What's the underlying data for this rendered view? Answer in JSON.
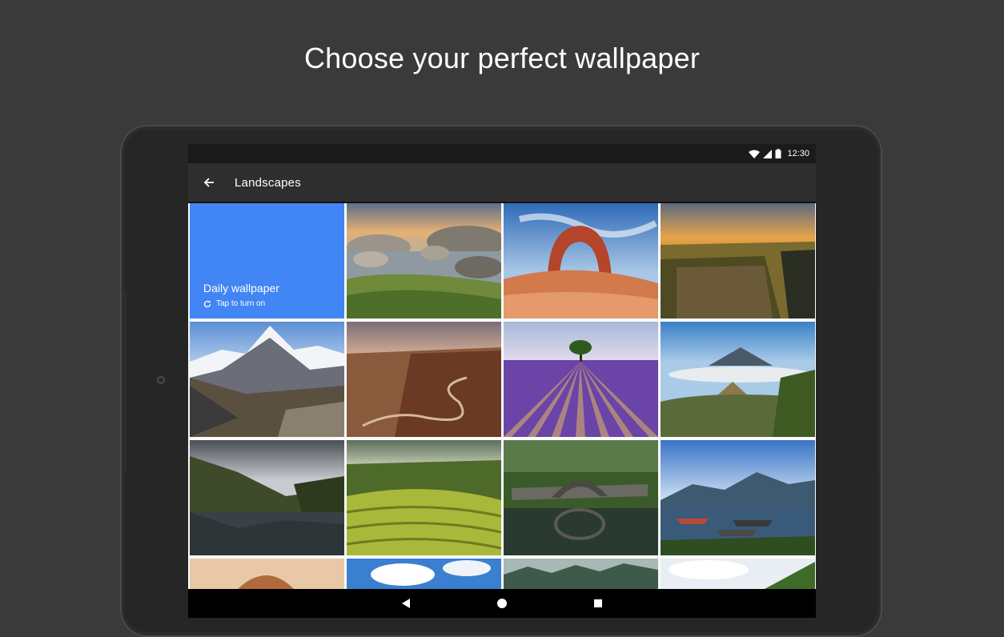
{
  "promo": {
    "title": "Choose your perfect wallpaper"
  },
  "status_bar": {
    "time": "12:30",
    "icons": [
      "wifi-icon",
      "cell-signal-icon",
      "battery-icon"
    ]
  },
  "app_bar": {
    "title": "Landscapes",
    "back_icon": "arrow-left-icon"
  },
  "daily_wallpaper": {
    "title": "Daily wallpaper",
    "subtitle": "Tap to turn on",
    "icon": "refresh-icon",
    "color": "#4285f4"
  },
  "wallpapers": [
    {
      "name": "rocky-lake"
    },
    {
      "name": "desert-arch"
    },
    {
      "name": "canyon-sunset"
    },
    {
      "name": "snowy-peak"
    },
    {
      "name": "winding-road-canyon"
    },
    {
      "name": "lavender-field-tree"
    },
    {
      "name": "volcano-valley"
    },
    {
      "name": "mountain-lake-reflection"
    },
    {
      "name": "rice-terraces"
    },
    {
      "name": "stone-bridge"
    },
    {
      "name": "boats-mountain-lake"
    },
    {
      "name": "desert-mesa"
    },
    {
      "name": "blue-sky-clouds"
    },
    {
      "name": "misty-forest"
    },
    {
      "name": "cloudy-green-hills"
    }
  ],
  "nav_bar": {
    "back_icon": "triangle-back-icon",
    "home_icon": "circle-home-icon",
    "recents_icon": "square-recents-icon"
  }
}
